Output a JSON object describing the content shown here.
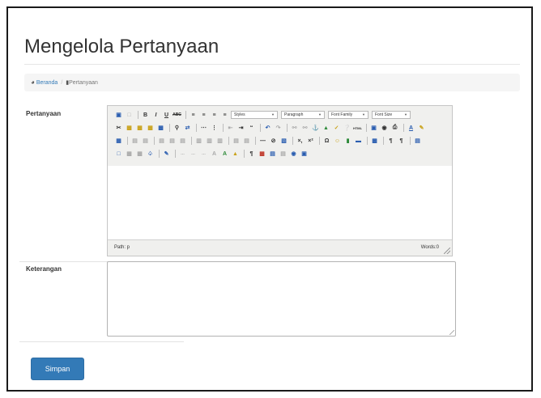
{
  "page": {
    "title": "Mengelola Pertanyaan"
  },
  "breadcrumb": {
    "home_label": "Beranda",
    "current_label": "Pertanyaan",
    "home_icon": "dashboard-icon",
    "current_icon": "file-icon"
  },
  "form": {
    "question_label": "Pertanyaan",
    "description_label": "Keterangan",
    "description_value": "",
    "submit_label": "Simpan"
  },
  "editor": {
    "styles_select": "Styles",
    "paragraph_select": "Paragraph",
    "font_family_select": "Font Family",
    "font_size_select": "Font Size",
    "path_label": "Path: p",
    "word_count": "Words:0",
    "content": "",
    "toolbar_icons_row1": [
      "save-icon",
      "new-document-icon",
      "bold-icon",
      "italic-icon",
      "underline-icon",
      "strikethrough-icon",
      "align-left-icon",
      "align-center-icon",
      "align-right-icon",
      "align-justify-icon"
    ],
    "toolbar_icons_row2": [
      "cut-icon",
      "copy-icon",
      "paste-icon",
      "paste-text-icon",
      "paste-word-icon",
      "find-icon",
      "replace-icon",
      "bullet-list-icon",
      "numbered-list-icon",
      "outdent-icon",
      "indent-icon",
      "blockquote-icon",
      "undo-icon",
      "redo-icon",
      "link-icon",
      "unlink-icon",
      "anchor-icon",
      "image-icon",
      "cleanup-icon",
      "help-icon",
      "html-icon",
      "media-icon",
      "preview-icon",
      "print-icon",
      "text-color-icon",
      "highlight-color-icon"
    ],
    "toolbar_icons_row3": [
      "table-icon",
      "row-props-icon",
      "cell-props-icon",
      "insert-row-before-icon",
      "insert-row-after-icon",
      "delete-row-icon",
      "insert-col-icon",
      "delete-col-icon",
      "split-cells-icon",
      "merge-cells-icon",
      "horizontal-rule-icon",
      "remove-format-icon",
      "visual-aid-icon",
      "subscript-icon",
      "superscript-icon",
      "char-map-icon",
      "emoticon-icon",
      "media-insert-icon",
      "advanced-hr-icon",
      "fullscreen-icon",
      "ltr-icon",
      "rtl-icon",
      "edit-css-icon"
    ],
    "toolbar_icons_row4": [
      "layer-insert-icon",
      "move-forward-icon",
      "move-backward-icon",
      "absolute-icon",
      "style-props-icon",
      "cite-icon",
      "abbr-icon",
      "acronym-icon",
      "del-icon",
      "ins-icon",
      "attribs-icon",
      "visual-chars-icon",
      "non-breaking-icon",
      "template-icon",
      "page-break-icon",
      "restore-draft-icon",
      "spellcheck-icon"
    ]
  }
}
